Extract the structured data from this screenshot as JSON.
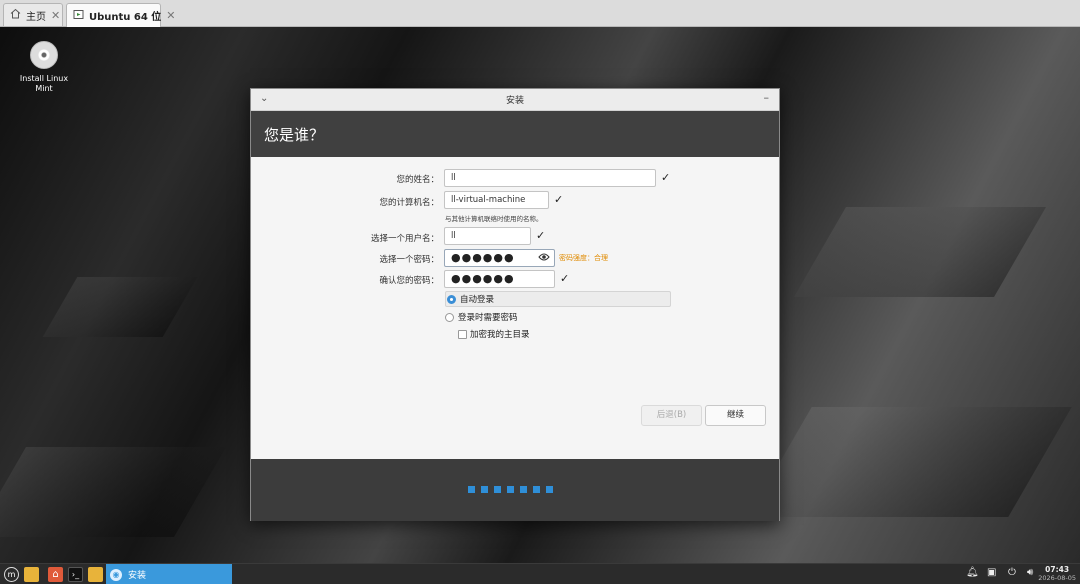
{
  "host": {
    "tabs": [
      {
        "label": "主页"
      },
      {
        "label": "Ubuntu 64 位"
      }
    ]
  },
  "desktop": {
    "icon_label": "Install Linux Mint"
  },
  "installer": {
    "window_title": "安装",
    "header": "您是谁？",
    "labels": {
      "name": "您的姓名：",
      "computer": "您的计算机名：",
      "username": "选择一个用户名：",
      "password": "选择一个密码：",
      "confirm": "确认您的密码："
    },
    "values": {
      "name": "ll",
      "computer": "ll-virtual-machine",
      "username": "ll",
      "password_mask": "●●●●●●",
      "confirm_mask": "●●●●●●"
    },
    "computer_hint": "与其他计算机联络时使用的名称。",
    "password_strength": "密码强度：合理",
    "login_options": {
      "auto_login": "自动登录",
      "require_password": "登录时需要密码",
      "encrypt_home": "加密我的主目录",
      "selected": "auto_login"
    },
    "buttons": {
      "back": "后退(B)",
      "continue": "继续"
    },
    "progress_steps": 7
  },
  "taskbar": {
    "task_label": "安装",
    "time": "07:43",
    "date": "2026-08-05"
  },
  "colors": {
    "accent": "#3a99dc",
    "strength": "#e08a00",
    "header_bg": "#404040"
  }
}
